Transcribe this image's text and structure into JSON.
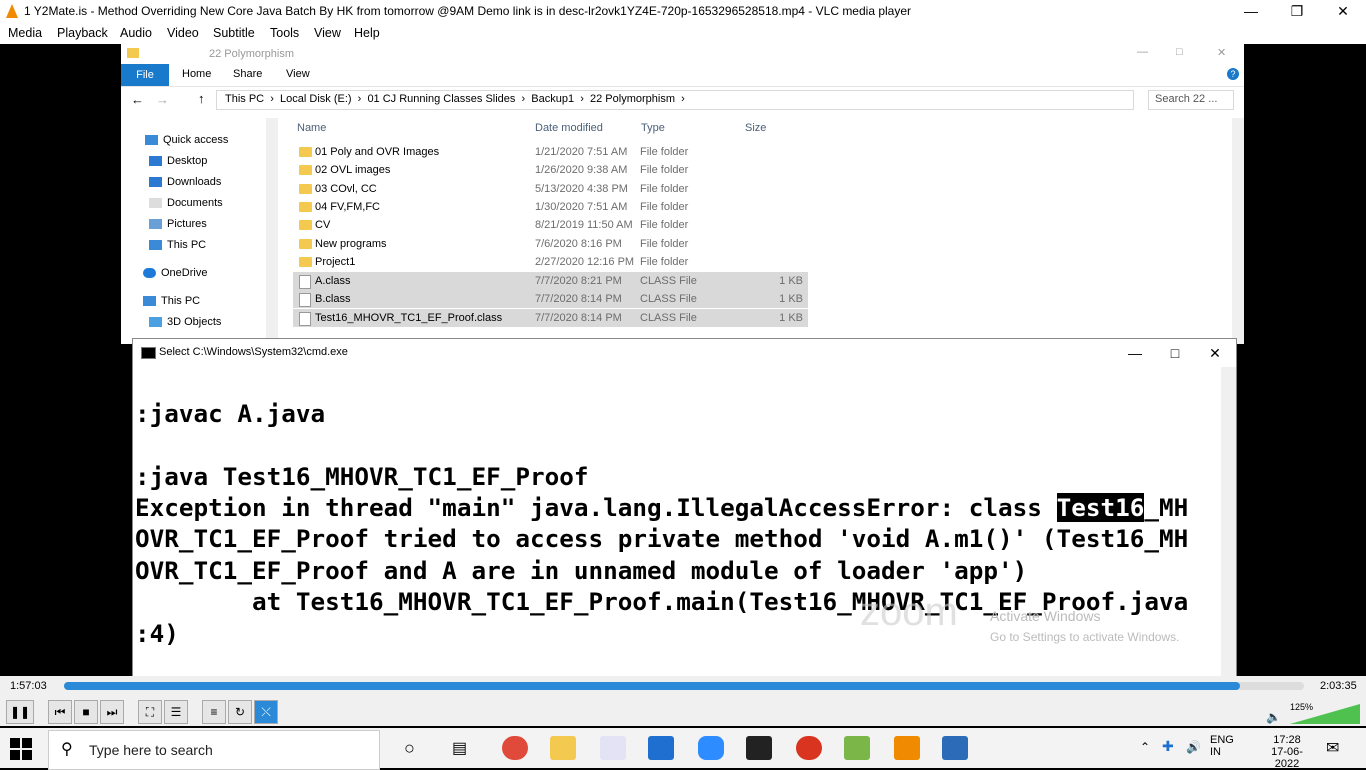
{
  "vlc": {
    "title": "1 Y2Mate.is - Method Overriding  New Core Java Batch By HK from tomorrow @9AM  Demo link is in desc-lr2ovk1YZ4E-720p-1653296528518.mp4 - VLC media player",
    "menu": [
      "Media",
      "Playback",
      "Audio",
      "Video",
      "Subtitle",
      "Tools",
      "View",
      "Help"
    ],
    "time_elapsed": "1:57:03",
    "time_total": "2:03:35",
    "progress": 0.948,
    "volume": "125%"
  },
  "explorer": {
    "window_title": "22 Polymorphism",
    "ribbon_tabs": [
      "File",
      "Home",
      "Share",
      "View"
    ],
    "breadcrumb": [
      "This PC",
      "Local Disk (E:)",
      "01 CJ Running Classes Slides",
      "Backup1",
      "22 Polymorphism"
    ],
    "search_placeholder": "Search 22 ...",
    "nav": [
      "Quick access",
      "Desktop",
      "Downloads",
      "Documents",
      "Pictures",
      "This PC",
      "OneDrive",
      "This PC",
      "3D Objects"
    ],
    "columns": [
      "Name",
      "Date modified",
      "Type",
      "Size"
    ],
    "files": [
      {
        "name": "01 Poly and OVR Images",
        "date": "1/21/2020 7:51 AM",
        "type": "File folder",
        "size": ""
      },
      {
        "name": "02 OVL images",
        "date": "1/26/2020 9:38 AM",
        "type": "File folder",
        "size": ""
      },
      {
        "name": "03 COvl, CC",
        "date": "5/13/2020 4:38 PM",
        "type": "File folder",
        "size": ""
      },
      {
        "name": "04 FV,FM,FC",
        "date": "1/30/2020 7:51 AM",
        "type": "File folder",
        "size": ""
      },
      {
        "name": "CV",
        "date": "8/21/2019 11:50 AM",
        "type": "File folder",
        "size": ""
      },
      {
        "name": "New programs",
        "date": "7/6/2020 8:16 PM",
        "type": "File folder",
        "size": ""
      },
      {
        "name": "Project1",
        "date": "2/27/2020 12:16 PM",
        "type": "File folder",
        "size": ""
      },
      {
        "name": "A.class",
        "date": "7/7/2020 8:21 PM",
        "type": "CLASS File",
        "size": "1 KB"
      },
      {
        "name": "B.class",
        "date": "7/7/2020 8:14 PM",
        "type": "CLASS File",
        "size": "1 KB"
      },
      {
        "name": "Test16_MHOVR_TC1_EF_Proof.class",
        "date": "7/7/2020 8:14 PM",
        "type": "CLASS File",
        "size": "1 KB"
      }
    ]
  },
  "cmd": {
    "title": "Select C:\\Windows\\System32\\cmd.exe",
    "line1": ":javac A.java",
    "line2": ":java Test16_MHOVR_TC1_EF_Proof",
    "line3_pre": "Exception in thread \"main\" java.lang.IllegalAccessError: class ",
    "line3_hl": "Test16",
    "line3_post": "_MH",
    "line4": "OVR_TC1_EF_Proof tried to access private method 'void A.m1()' (Test16_MH",
    "line5": "OVR_TC1_EF_Proof and A are in unnamed module of loader 'app')",
    "line6": "        at Test16_MHOVR_TC1_EF_Proof.main(Test16_MHOVR_TC1_EF_Proof.java",
    "line7": ":4)",
    "watermark": "zoom",
    "activate1": "Activate Windows",
    "activate2": "Go to Settings to activate Windows."
  },
  "taskbar": {
    "search_placeholder": "Type here to search",
    "lang1": "ENG",
    "lang2": "IN",
    "time": "17:28",
    "date": "17-06-2022"
  }
}
